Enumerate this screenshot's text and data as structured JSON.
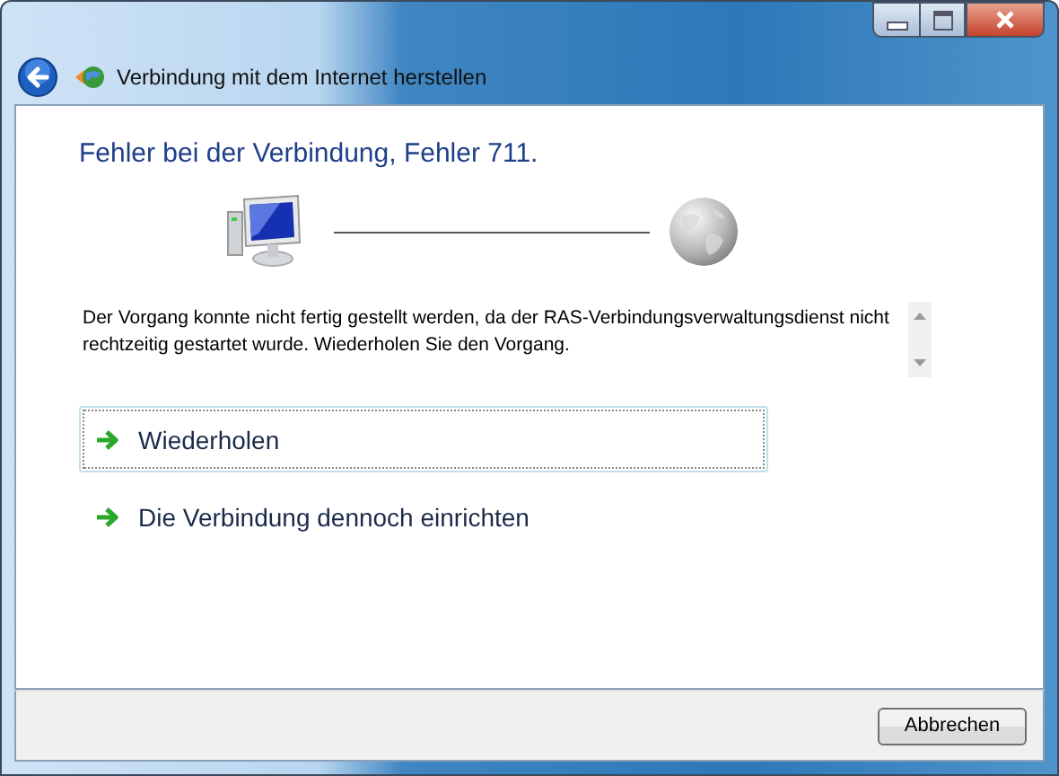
{
  "window": {
    "title": "Verbindung mit dem Internet herstellen"
  },
  "heading": "Fehler bei der Verbindung, Fehler 711.",
  "message": "Der Vorgang konnte nicht fertig gestellt werden, da der RAS-Verbindungsverwaltungsdienst nicht rechtzeitig gestartet wurde. Wiederholen Sie den Vorgang.",
  "commands": [
    {
      "label": "Wiederholen",
      "focused": true
    },
    {
      "label": "Die Verbindung dennoch einrichten",
      "focused": false
    }
  ],
  "buttons": [
    "Abbrechen"
  ]
}
